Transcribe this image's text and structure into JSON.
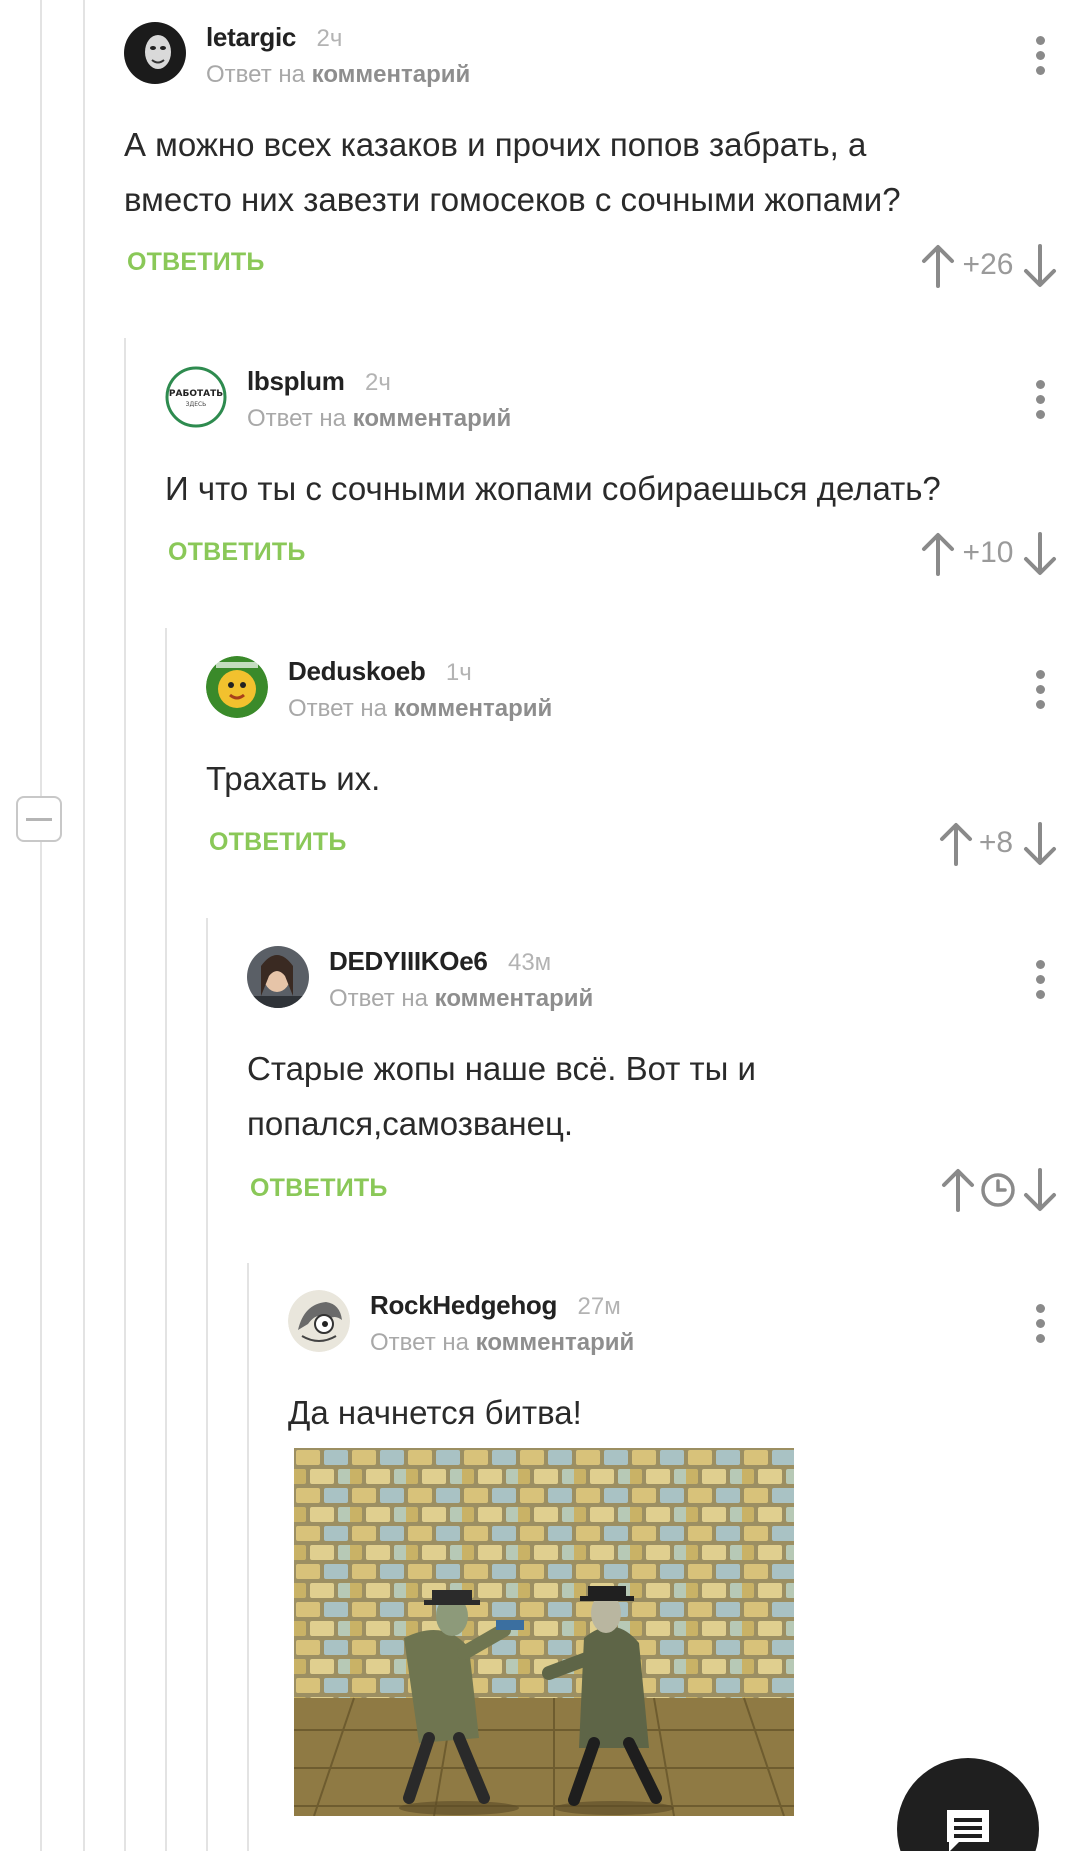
{
  "comments": [
    {
      "username": "letargic",
      "time": "2ч",
      "reply_prefix": "Ответ на",
      "reply_target": "комментарий",
      "text_lines": [
        "А можно всех казаков и прочих попов забрать, а",
        "вместо них завезти гомосеков с сочными жопами?"
      ],
      "reply_label": "ОТВЕТИТЬ",
      "score": "+26"
    },
    {
      "username": "lbsplum",
      "time": "2ч",
      "reply_prefix": "Ответ на",
      "reply_target": "комментарий",
      "text_lines": [
        "И что ты с сочными жопами собираешься делать?"
      ],
      "reply_label": "ОТВЕТИТЬ",
      "score": "+10",
      "avatar_text": [
        "РАБОТАТЬ",
        "ЗДЕСЬ"
      ]
    },
    {
      "username": "Deduskoeb",
      "time": "1ч",
      "reply_prefix": "Ответ на",
      "reply_target": "комментарий",
      "text_lines": [
        "Трахать их."
      ],
      "reply_label": "ОТВЕТИТЬ",
      "score": "+8"
    },
    {
      "username": "DEDYIIIKOe6",
      "time": "43м",
      "reply_prefix": "Ответ на",
      "reply_target": "комментарий",
      "text_lines": [
        "Старые жопы наше всё. Вот ты и",
        "попался,самозванец."
      ],
      "reply_label": "ОТВЕТИТЬ",
      "score_icon": "clock-icon"
    },
    {
      "username": "RockHedgehog",
      "time": "27м",
      "reply_prefix": "Ответ на",
      "reply_target": "комментарий",
      "text_lines": [
        "Да начнется битва!"
      ],
      "image_icon": "cartoon-scene-image"
    }
  ],
  "colors": {
    "accent": "#8ac858",
    "line": "#e3e3e3",
    "fab": "#1f1f1f"
  },
  "icons": {
    "upvote": "arrow-up-icon",
    "downvote": "arrow-down-icon",
    "more": "more-vertical-icon",
    "collapse": "collapse-minus-icon",
    "fab": "comment-icon"
  }
}
